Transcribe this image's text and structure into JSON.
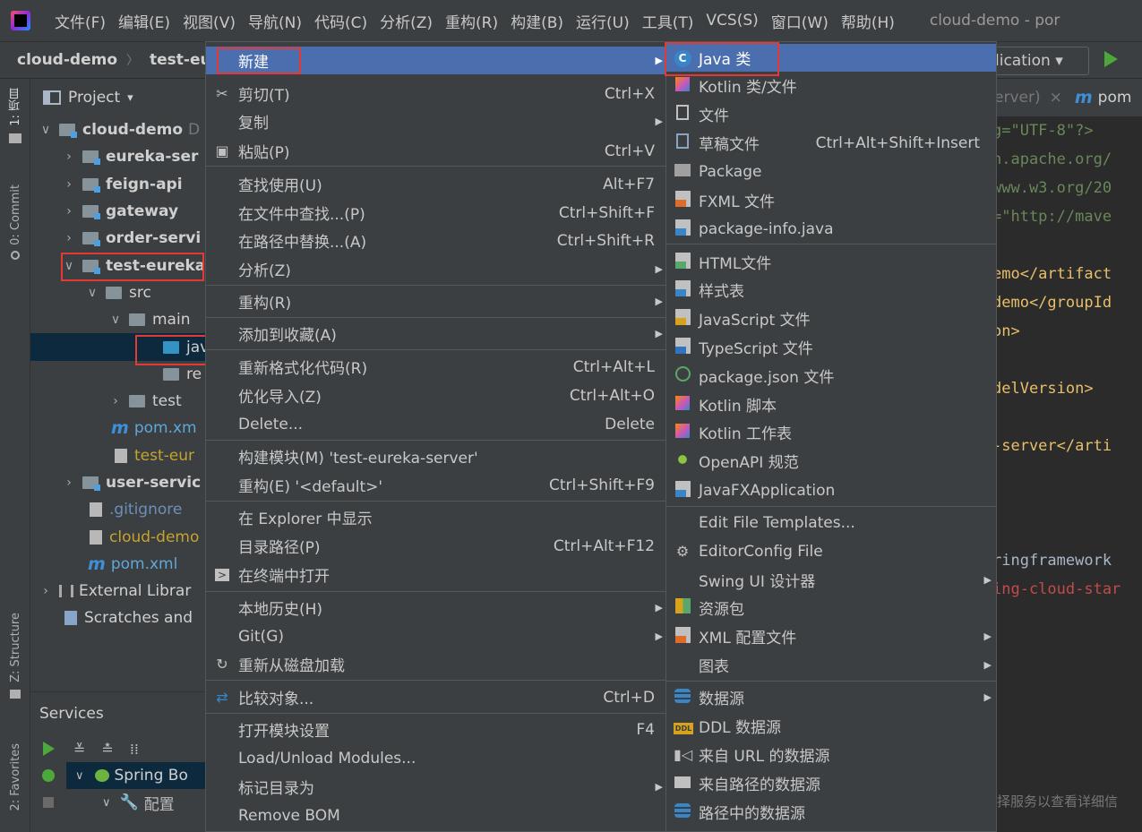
{
  "menubar": {
    "items": [
      "文件(F)",
      "编辑(E)",
      "视图(V)",
      "导航(N)",
      "代码(C)",
      "分析(Z)",
      "重构(R)",
      "构建(B)",
      "运行(U)",
      "工具(T)",
      "VCS(S)",
      "窗口(W)",
      "帮助(H)"
    ],
    "window_title": "cloud-demo - por"
  },
  "navbar": {
    "crumbs": [
      "cloud-demo",
      "test-eur"
    ],
    "run_config": "lication"
  },
  "left_strip": {
    "project_tab": "1: 项目",
    "commit_tab": "0: Commit",
    "structure_tab": "Z: Structure",
    "favorites_tab": "2: Favorites"
  },
  "project": {
    "header": "Project",
    "rows": [
      {
        "text": "cloud-demo",
        "suffix": "D"
      },
      {
        "text": "eureka-ser"
      },
      {
        "text": "feign-api"
      },
      {
        "text": "gateway"
      },
      {
        "text": "order-servi"
      },
      {
        "text": "test-eureka"
      },
      {
        "text": "src"
      },
      {
        "text": "main"
      },
      {
        "text": "jav"
      },
      {
        "text": "re"
      },
      {
        "text": "test"
      },
      {
        "text": "pom.xm"
      },
      {
        "text": "test-eur"
      },
      {
        "text": "user-servic"
      },
      {
        "text": ".gitignore"
      },
      {
        "text": "cloud-demo"
      },
      {
        "text": "pom.xml"
      },
      {
        "text": "External Librar"
      },
      {
        "text": "Scratches and"
      }
    ]
  },
  "services": {
    "title": "Services",
    "spring": "Spring Bo",
    "config": "配置"
  },
  "editor": {
    "tabs": [
      "erver)",
      "pom"
    ],
    "lines": [
      {
        "t": "g=\"UTF-8\"?>"
      },
      {
        "t": "n.apache.org/"
      },
      {
        "t": "www.w3.org/20"
      },
      {
        "t": "=\"http://mave"
      },
      {
        "t": ""
      },
      {
        "t": "emo</artifact"
      },
      {
        "t": "demo</groupId"
      },
      {
        "t": "on>"
      },
      {
        "t": ""
      },
      {
        "t": "delVersion>"
      },
      {
        "t": ""
      },
      {
        "t": "-server</arti"
      },
      {
        "t": ""
      },
      {
        "t": ""
      },
      {
        "t": ""
      },
      {
        "t": "ringframework"
      },
      {
        "t": "ing-cloud-star"
      }
    ],
    "status": "选择服务以查看详细信"
  },
  "context_menu": {
    "new": "新建",
    "cut": "剪切(T)",
    "cut_sc": "Ctrl+X",
    "copy": "复制",
    "paste": "粘贴(P)",
    "paste_sc": "Ctrl+V",
    "find_usages": "查找使用(U)",
    "find_usages_sc": "Alt+F7",
    "find_in_files": "在文件中查找...(P)",
    "find_in_files_sc": "Ctrl+Shift+F",
    "replace_in_path": "在路径中替换...(A)",
    "replace_in_path_sc": "Ctrl+Shift+R",
    "analyze": "分析(Z)",
    "refactor": "重构(R)",
    "add_favorites": "添加到收藏(A)",
    "reformat": "重新格式化代码(R)",
    "reformat_sc": "Ctrl+Alt+L",
    "optimize_imports": "优化导入(Z)",
    "optimize_imports_sc": "Ctrl+Alt+O",
    "delete": "Delete...",
    "delete_sc": "Delete",
    "build_module": "构建模块(M) 'test-eureka-server'",
    "rebuild": "重构(E) '<default>'",
    "rebuild_sc": "Ctrl+Shift+F9",
    "show_explorer": "在 Explorer 中显示",
    "dir_path": "目录路径(P)",
    "dir_path_sc": "Ctrl+Alt+F12",
    "open_terminal": "在终端中打开",
    "local_history": "本地历史(H)",
    "git": "Git(G)",
    "reload_disk": "重新从磁盘加载",
    "compare_with": "比较对象...",
    "compare_with_sc": "Ctrl+D",
    "module_settings": "打开模块设置",
    "module_settings_sc": "F4",
    "load_unload": "Load/Unload Modules...",
    "mark_dir": "标记目录为",
    "remove_bom": "Remove BOM"
  },
  "sub_menu": {
    "java_class": "Java 类",
    "kotlin_class": "Kotlin 类/文件",
    "file": "文件",
    "scratch": "草稿文件",
    "scratch_sc": "Ctrl+Alt+Shift+Insert",
    "package": "Package",
    "fxml": "FXML 文件",
    "package_info": "package-info.java",
    "html": "HTML文件",
    "stylesheet": "样式表",
    "javascript": "JavaScript 文件",
    "typescript": "TypeScript 文件",
    "package_json": "package.json 文件",
    "kotlin_script": "Kotlin 脚本",
    "kotlin_worksheet": "Kotlin 工作表",
    "openapi": "OpenAPI 规范",
    "javafx": "JavaFXApplication",
    "edit_templates": "Edit File Templates...",
    "editorconfig": "EditorConfig File",
    "swing_ui": "Swing UI 设计器",
    "resource_bundle": "资源包",
    "xml_config": "XML 配置文件",
    "diagram": "图表",
    "datasource": "数据源",
    "ddl_datasource": "DDL 数据源",
    "url_datasource": "来自 URL 的数据源",
    "path_datasource": "来自路径的数据源",
    "path_datasources": "路径中的数据源"
  }
}
